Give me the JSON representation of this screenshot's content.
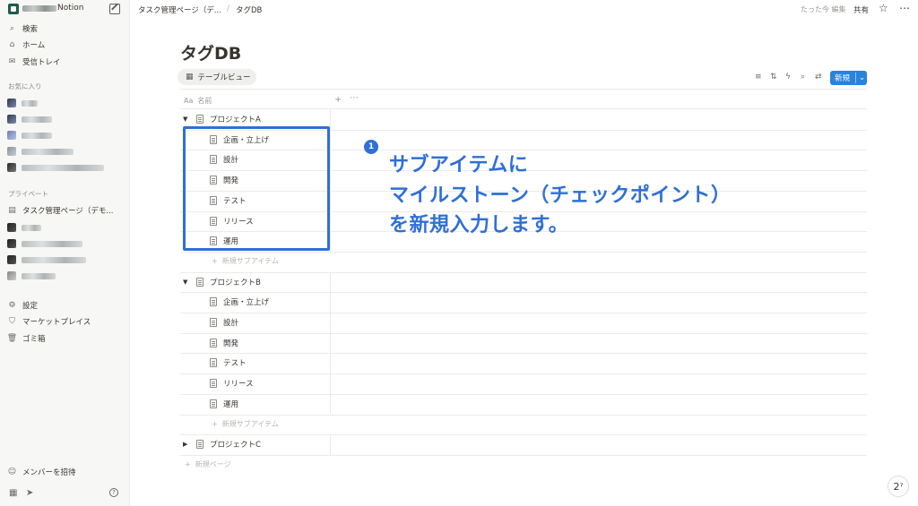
{
  "workspace": {
    "name_suffix": "Notion"
  },
  "sidebar": {
    "top": [
      {
        "label": "検索",
        "icon": "search-icon"
      },
      {
        "label": "ホーム",
        "icon": "home-icon"
      },
      {
        "label": "受信トレイ",
        "icon": "inbox-icon"
      }
    ],
    "favorites_label": "お気に入り",
    "private_label": "プライベート",
    "private_items": [
      {
        "label": "タスク管理ページ（デモ..."
      }
    ],
    "bottom": [
      {
        "label": "設定",
        "icon": "gear-icon"
      },
      {
        "label": "マーケットプレイス",
        "icon": "marketplace-icon"
      },
      {
        "label": "ゴミ箱",
        "icon": "trash-icon"
      }
    ],
    "invite_label": "メンバーを招待"
  },
  "header": {
    "breadcrumb": [
      "タスク管理ページ（デ...",
      "タグDB"
    ],
    "edited": "たった今 編集",
    "share": "共有"
  },
  "page": {
    "title": "タグDB",
    "view_tab": "テーブルビュー",
    "new_button": "新規",
    "column_name": "名前",
    "column_prefix": "Aa"
  },
  "groups": [
    {
      "name": "プロジェクトA",
      "expanded": true,
      "items": [
        "企画・立上げ",
        "設計",
        "開発",
        "テスト",
        "リリース",
        "運用"
      ],
      "add_label": "新規サブアイテム"
    },
    {
      "name": "プロジェクトB",
      "expanded": true,
      "items": [
        "企画・立上げ",
        "設計",
        "開発",
        "テスト",
        "リリース",
        "運用"
      ],
      "add_label": "新規サブアイテム"
    },
    {
      "name": "プロジェクトC",
      "expanded": false,
      "items": []
    }
  ],
  "new_page_label": "新規ページ",
  "annotation": {
    "badge": "1",
    "lines": [
      "サブアイテムに",
      "マイルストーン（チェックポイント）",
      "を新規入力します。"
    ],
    "color": "#2f6fd6"
  },
  "colors": {
    "accent": "#2783de",
    "annotation": "#2f6fd6"
  }
}
